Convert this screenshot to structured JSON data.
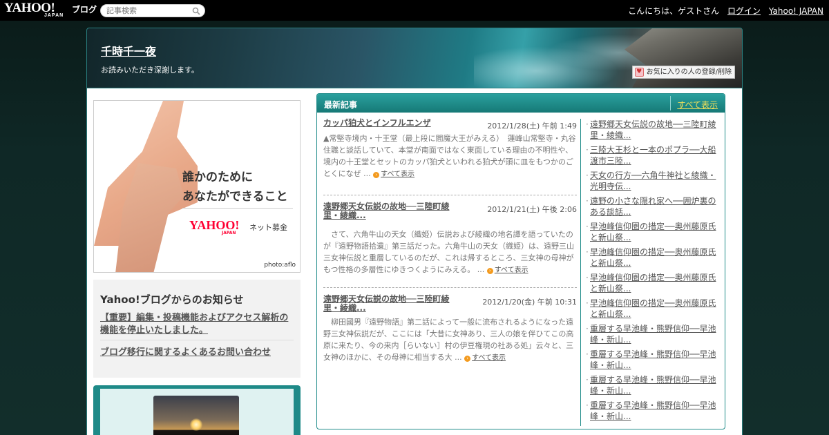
{
  "topbar": {
    "logo_main": "YAHOO!",
    "logo_sub": "JAPAN",
    "logo_blog": "ブログ",
    "search_placeholder": "記事検索",
    "greeting": "こんにちは、ゲストさん",
    "login": "ログイン",
    "yahoo_japan": "Yahoo! JAPAN"
  },
  "banner": {
    "title": "千時千一夜",
    "description": "お読みいただき深謝します。",
    "fav_button": "お気に入りの人の登録/削除"
  },
  "ad": {
    "line1": "誰かのために",
    "line2": "あなたができること",
    "brand": "YAHOO!",
    "brand_sub": "JAPAN",
    "service": "ネット募金",
    "credit": "photo:aflo"
  },
  "notice": {
    "title": "Yahoo!ブログからのお知らせ",
    "item1": "【重要】編集・投稿機能およびアクセス解析の機能を停止いたしました。",
    "item2": "ブログ移行に関するよくあるお問い合わせ"
  },
  "panel": {
    "title": "最新記事",
    "show_all": "すべて表示"
  },
  "posts": [
    {
      "title": "カッパ狛犬とインフルエンザ",
      "date": "2012/1/28(土) 午前 1:49",
      "body": "▲常堅寺境内・十王堂（最上段に閻魔大王がみえる）　蓮峰山常堅寺・丸谷住職と談話していて、本堂が南面ではなく東面している理由の不明性や、境内の十王堂とセットのカッパ狛犬といわれる狛犬が頭に皿をもつかのごとくになぜ ...",
      "more": "すべて表示"
    },
    {
      "title": "遠野郷天女伝説の故地──三陸町綾里・綾織...",
      "date": "2012/1/21(土) 午後 2:06",
      "body": "　さて、六角牛山の天女（織姫）伝説および綾織の地名譚を語っていたのが『遠野物語拾遺』第三話だった。六角牛山の天女（織姫）は、遠野三山三女神伝説と重層しているのだが、これは帰するところ、三女神の母神がもつ性格の多層性にゆきつくようにみえる。 ...",
      "more": "すべて表示"
    },
    {
      "title": "遠野郷天女伝説の故地──三陸町綾里・綾織...",
      "date": "2012/1/20(金) 午前 10:31",
      "body": "　柳田國男『遠野物語』第二話によって一般に流布されるようになった遠野三女神伝説だが、ここには「大昔に女神あり、三人の娘を伴ひてこの高原に来たり、今の来内［らいない］村の伊豆権現の社ある処」云々と、三女神のほかに、その母神に相当する大 ...",
      "more": "すべて表示"
    }
  ],
  "side_links": [
    "遠野郷天女伝説の故地──三陸町綾里・綾織...",
    "三陸大王杉と一本のポプラ──大船渡市三陸...",
    "天女の行方──六角牛神社と綾織・光明寺伝...",
    "遠野の小さな隠れ家へ──囲炉裏のある談話...",
    "早池峰信仰圏の措定──奥州藤原氏と新山祭...",
    "早池峰信仰圏の措定──奥州藤原氏と新山祭...",
    "早池峰信仰圏の措定──奥州藤原氏と新山祭...",
    "早池峰信仰圏の措定──奥州藤原氏と新山祭...",
    "重層する早池峰・熊野信仰──早池峰・新山...",
    "重層する早池峰・熊野信仰──早池峰・新山...",
    "重層する早池峰・熊野信仰──早池峰・新山...",
    "重層する早池峰・熊野信仰──早池峰・新山..."
  ],
  "colors": {
    "accent": "#1e8a88",
    "more_icon": "#f39a1e",
    "topbar": "#000000"
  }
}
